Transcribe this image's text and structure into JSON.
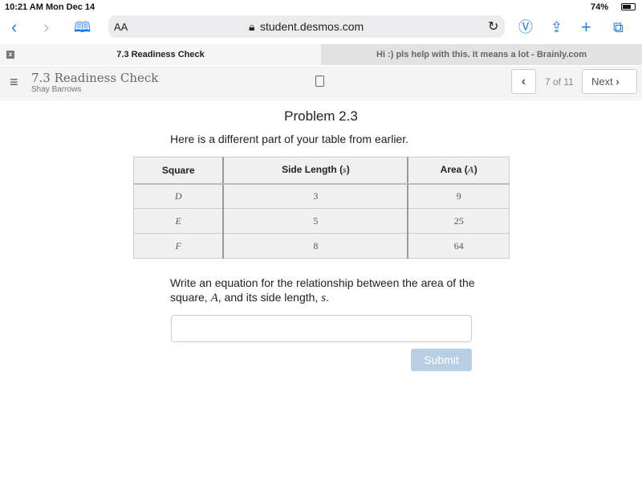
{
  "status": {
    "time": "10:21 AM",
    "date": "Mon Dec 14",
    "battery": "74%"
  },
  "browser": {
    "text_size": "AA",
    "url": "student.desmos.com"
  },
  "tabs": [
    {
      "label": "7.3 Readiness Check",
      "active": true
    },
    {
      "label": "Hi :) pls help with this. It means a lot - Brainly.com",
      "active": false
    }
  ],
  "header": {
    "title": "7.3 Readiness Check",
    "student": "Shay Barrows",
    "page": "7 of 11",
    "next_label": "Next"
  },
  "problem": {
    "title": "Problem 2.3",
    "intro": "Here is a different part of your table from earlier.",
    "table": {
      "headers": [
        {
          "pre": "Square",
          "var": "",
          "post": ""
        },
        {
          "pre": "Side Length (",
          "var": "s",
          "post": ")"
        },
        {
          "pre": "Area (",
          "var": "A",
          "post": ")"
        }
      ],
      "rows": [
        [
          "D",
          "3",
          "9"
        ],
        [
          "E",
          "5",
          "25"
        ],
        [
          "F",
          "8",
          "64"
        ]
      ]
    },
    "question": {
      "p1": "Write an equation for the relationship between the area of the square, ",
      "v1": "A",
      "p2": ", and its side length, ",
      "v2": "s",
      "p3": "."
    },
    "answer_value": "",
    "submit_label": "Submit"
  },
  "colors": {
    "accent": "#1a7cf5",
    "submit_disabled": "#b8cfe5"
  }
}
